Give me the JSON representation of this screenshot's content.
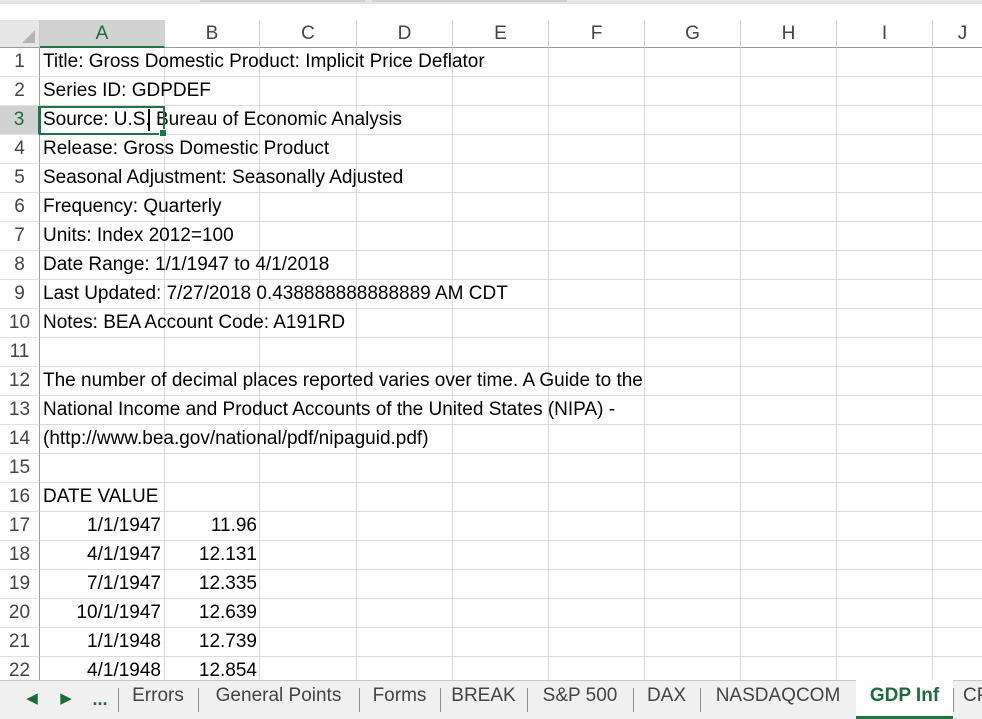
{
  "columns": [
    "A",
    "B",
    "C",
    "D",
    "E",
    "F",
    "G",
    "H",
    "I",
    "J"
  ],
  "selected_column": "A",
  "selected_row": "3",
  "rows": [
    {
      "num": "1",
      "a": "Title: Gross Domestic Product: Implicit Price Deflator",
      "b": ""
    },
    {
      "num": "2",
      "a": "Series ID: GDPDEF",
      "b": ""
    },
    {
      "num": "3",
      "a": "Source: U.S. Bureau of Economic Analysis",
      "b": ""
    },
    {
      "num": "4",
      "a": "Release: Gross Domestic Product",
      "b": ""
    },
    {
      "num": "5",
      "a": "Seasonal Adjustment: Seasonally Adjusted",
      "b": ""
    },
    {
      "num": "6",
      "a": "Frequency: Quarterly",
      "b": ""
    },
    {
      "num": "7",
      "a": "Units: Index 2012=100",
      "b": ""
    },
    {
      "num": "8",
      "a": "Date Range: 1/1/1947 to 4/1/2018",
      "b": ""
    },
    {
      "num": "9",
      "a": "Last Updated: 7/27/2018 0.438888888888889 AM CDT",
      "b": ""
    },
    {
      "num": "10",
      "a": "Notes: BEA Account Code: A191RD",
      "b": ""
    },
    {
      "num": "11",
      "a": "",
      "b": ""
    },
    {
      "num": "12",
      "a": " The number of decimal places reported varies over time. A Guide to the",
      "b": ""
    },
    {
      "num": "13",
      "a": " National Income and Product Accounts of the United States (NIPA) -",
      "b": ""
    },
    {
      "num": "14",
      "a": " (http://www.bea.gov/national/pdf/nipaguid.pdf)",
      "b": ""
    },
    {
      "num": "15",
      "a": "",
      "b": ""
    },
    {
      "num": "16",
      "a": "DATE VALUE",
      "b": ""
    },
    {
      "num": "17",
      "a": "1/1/1947",
      "b": "11.96"
    },
    {
      "num": "18",
      "a": "4/1/1947",
      "b": "12.131"
    },
    {
      "num": "19",
      "a": "7/1/1947",
      "b": "12.335"
    },
    {
      "num": "20",
      "a": "10/1/1947",
      "b": "12.639"
    },
    {
      "num": "21",
      "a": "1/1/1948",
      "b": "12.739"
    },
    {
      "num": "22",
      "a": "4/1/1948",
      "b": "12.854"
    }
  ],
  "tabbar": {
    "prev": "◀",
    "next": "▶",
    "more": "...",
    "tabs": [
      "Errors",
      "General Points",
      "Forms",
      "BREAK",
      "S&P 500",
      "DAX",
      "NASDAQCOM",
      "GDP Inf",
      "CP"
    ],
    "active_tab": "GDP Inf"
  },
  "colors": {
    "accent": "#217346",
    "header_selected": "#d2d2d2",
    "gridline": "#dadada"
  }
}
